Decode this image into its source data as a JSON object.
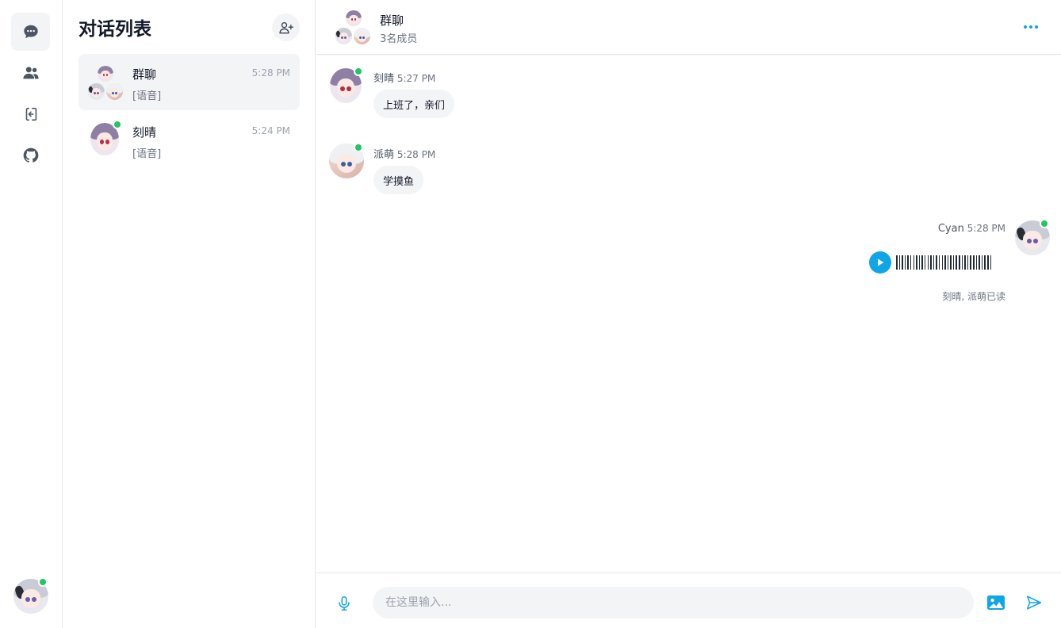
{
  "sidebar": {
    "items": [
      {
        "icon": "chat-bubble-icon",
        "active": true
      },
      {
        "icon": "users-icon",
        "active": false
      },
      {
        "icon": "logout-icon",
        "active": false
      },
      {
        "icon": "github-icon",
        "active": false
      }
    ]
  },
  "conversation_list": {
    "title": "对话列表",
    "items": [
      {
        "name": "群聊",
        "last_message": "[语音]",
        "time": "5:28 PM",
        "active": true
      },
      {
        "name": "刻晴",
        "last_message": "[语音]",
        "time": "5:24 PM",
        "active": false
      }
    ]
  },
  "chat": {
    "title": "群聊",
    "subtitle": "3名成员",
    "messages": [
      {
        "sender": "刻晴",
        "time": "5:27 PM",
        "text": "上班了，亲们"
      },
      {
        "sender": "派萌",
        "time": "5:28 PM",
        "text": "学摸鱼"
      },
      {
        "sender": "Cyan",
        "time": "5:28 PM",
        "type": "voice",
        "read_receipt": "刻晴, 派萌已读"
      }
    ]
  },
  "composer": {
    "placeholder": "在这里输入..."
  },
  "colors": {
    "accent": "#0ea5e9",
    "online": "#22c55e",
    "bubble": "#f3f4f6"
  }
}
